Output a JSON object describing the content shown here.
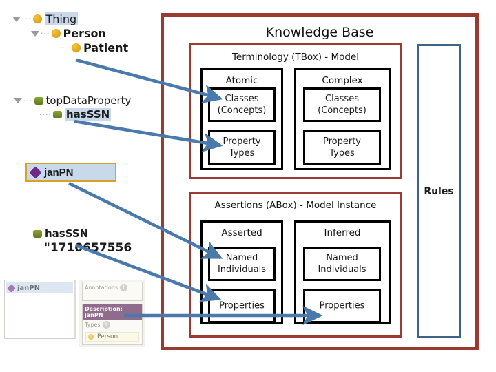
{
  "diagram": {
    "kb": {
      "title": "Knowledge Base"
    },
    "tbox": {
      "title": "Terminology (TBox) - Model",
      "columns": [
        {
          "title": "Atomic",
          "items": [
            "Classes\n(Concepts)",
            "Property\nTypes"
          ]
        },
        {
          "title": "Complex",
          "items": [
            "Classes\n(Concepts)",
            "Property\nTypes"
          ]
        }
      ]
    },
    "abox": {
      "title": "Assertions (ABox) - Model Instance",
      "columns": [
        {
          "title": "Asserted",
          "items": [
            "Named\nIndividuals",
            "Properties"
          ]
        },
        {
          "title": "Inferred",
          "items": [
            "Named\nIndividuals",
            "Properties"
          ]
        }
      ]
    },
    "rules": {
      "label": "Rules"
    }
  },
  "protege": {
    "class_tree": [
      {
        "label": "Thing",
        "icon": "class-circle-icon",
        "selected": true,
        "bold": false
      },
      {
        "label": "Person",
        "icon": "class-circle-icon",
        "selected": false,
        "bold": true
      },
      {
        "label": "Patient",
        "icon": "class-circle-icon",
        "selected": false,
        "bold": true
      }
    ],
    "property_tree": [
      {
        "label": "topDataProperty",
        "icon": "data-property-icon",
        "selected": false
      },
      {
        "label": "hasSSN",
        "icon": "data-property-icon",
        "selected": true
      }
    ],
    "individual": {
      "label": "janPN",
      "icon": "individual-diamond-icon"
    },
    "assertion": {
      "property": "hasSSN",
      "value": "\"1710657556",
      "icon": "data-property-icon"
    },
    "panel": {
      "list_item": "janPN",
      "annotations_header": "Annotations",
      "description_header": "Description: janPN",
      "types_header": "Types",
      "type_value": "Person",
      "plus_glyph": "+"
    }
  },
  "colors": {
    "kb_border": "#9b3a31",
    "section_border": "#9b3a31",
    "rules_border": "#3d6387",
    "leaf_border": "#000000",
    "arrow": "#4a7aac",
    "class_icon": "#dfa81d",
    "property_icon": "#6f8a28",
    "individual_icon": "#6b2a86",
    "selection": "#c9d9ec"
  }
}
